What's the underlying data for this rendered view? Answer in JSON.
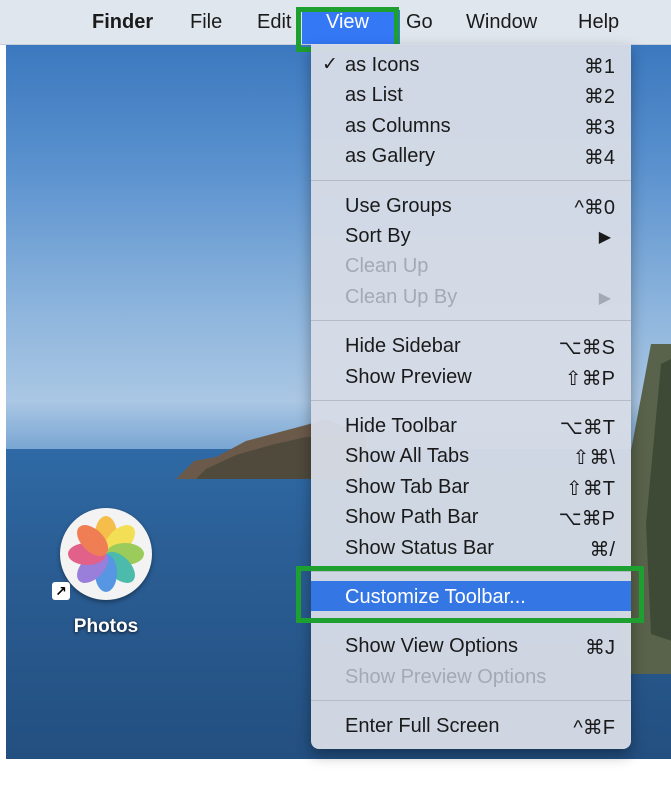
{
  "menubar": {
    "apple_glyph": "",
    "items": [
      "Finder",
      "File",
      "Edit",
      "View",
      "Go",
      "Window",
      "Help"
    ],
    "active": "View"
  },
  "view_menu": {
    "groups": [
      [
        {
          "label": "as Icons",
          "shortcut": "⌘1",
          "checked": true
        },
        {
          "label": "as List",
          "shortcut": "⌘2"
        },
        {
          "label": "as Columns",
          "shortcut": "⌘3"
        },
        {
          "label": "as Gallery",
          "shortcut": "⌘4"
        }
      ],
      [
        {
          "label": "Use Groups",
          "shortcut": "^⌘0"
        },
        {
          "label": "Sort By",
          "submenu": true
        },
        {
          "label": "Clean Up",
          "disabled": true
        },
        {
          "label": "Clean Up By",
          "disabled": true,
          "submenu": true
        }
      ],
      [
        {
          "label": "Hide Sidebar",
          "shortcut": "⌥⌘S"
        },
        {
          "label": "Show Preview",
          "shortcut": "⇧⌘P"
        }
      ],
      [
        {
          "label": "Hide Toolbar",
          "shortcut": "⌥⌘T"
        },
        {
          "label": "Show All Tabs",
          "shortcut": "⇧⌘\\"
        },
        {
          "label": "Show Tab Bar",
          "shortcut": "⇧⌘T"
        },
        {
          "label": "Show Path Bar",
          "shortcut": "⌥⌘P"
        },
        {
          "label": "Show Status Bar",
          "shortcut": "⌘/"
        }
      ],
      [
        {
          "label": "Customize Toolbar...",
          "selected": true
        }
      ],
      [
        {
          "label": "Show View Options",
          "shortcut": "⌘J"
        },
        {
          "label": "Show Preview Options",
          "disabled": true
        }
      ],
      [
        {
          "label": "Enter Full Screen",
          "shortcut": "^⌘F"
        }
      ]
    ],
    "checkmark": "✓",
    "submenu_arrow": "▶"
  },
  "desktop": {
    "icon_label": "Photos",
    "alias_glyph": "↗"
  },
  "colors": {
    "highlight": "#3476e4",
    "annotation_box": "#1ea030"
  }
}
